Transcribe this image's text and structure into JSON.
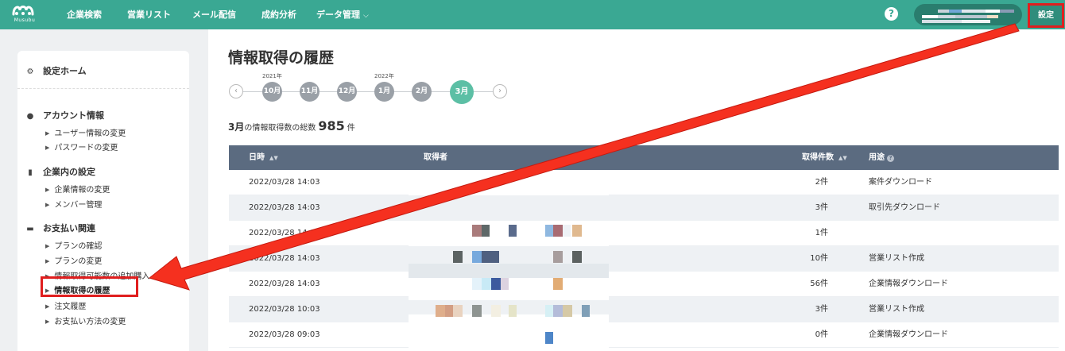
{
  "header": {
    "logo_text": "Musubu",
    "nav": [
      {
        "label": "企業検索"
      },
      {
        "label": "営業リスト"
      },
      {
        "label": "メール配信"
      },
      {
        "label": "成約分析"
      },
      {
        "label": "データ管理"
      }
    ],
    "settings_label": "設定",
    "help_icon": "question-circle-icon"
  },
  "sidebar": {
    "home": "設定ホーム",
    "sections": [
      {
        "title": "アカウント情報",
        "icon": "user-icon",
        "items": [
          "ユーザー情報の変更",
          "パスワードの変更"
        ]
      },
      {
        "title": "企業内の設定",
        "icon": "book-icon",
        "items": [
          "企業情報の変更",
          "メンバー管理"
        ]
      },
      {
        "title": "お支払い関連",
        "icon": "credit-card-icon",
        "items": [
          "プランの確認",
          "プランの変更",
          "情報取得可能数の追加購入",
          "情報取得の履歴",
          "注文履歴",
          "お支払い方法の変更"
        ]
      }
    ],
    "active_item": "情報取得の履歴"
  },
  "page": {
    "title": "情報取得の履歴",
    "timeline": {
      "years": [
        "2021年",
        "2022年"
      ],
      "months": [
        "10月",
        "11月",
        "12月",
        "1月",
        "2月",
        "3月"
      ],
      "current": "3月"
    },
    "summary": {
      "month": "3月",
      "text_before": "の情報取得数の総数",
      "total": "985",
      "unit": "件"
    }
  },
  "table": {
    "headers": {
      "date": "日時",
      "user": "取得者",
      "count": "取得件数",
      "purpose": "用途"
    },
    "rows": [
      {
        "date": "2022/03/28 14:03",
        "count": "2件",
        "purpose": "案件ダウンロード"
      },
      {
        "date": "2022/03/28 14:03",
        "count": "3件",
        "purpose": "取引先ダウンロード"
      },
      {
        "date": "2022/03/28 14:03",
        "count": "1件",
        "purpose": ""
      },
      {
        "date": "2022/03/28 14:03",
        "count": "10件",
        "purpose": "営業リスト作成"
      },
      {
        "date": "2022/03/28 14:03",
        "count": "56件",
        "purpose": "企業情報ダウンロード"
      },
      {
        "date": "2022/03/28 10:03",
        "count": "3件",
        "purpose": "営業リスト作成"
      },
      {
        "date": "2022/03/28 09:03",
        "count": "0件",
        "purpose": "企業情報ダウンロード"
      }
    ]
  },
  "colors": {
    "brand": "#3aa893",
    "table_header": "#5b6b80",
    "highlight": "#e01e1e",
    "timeline_current": "#5cbfa5"
  }
}
